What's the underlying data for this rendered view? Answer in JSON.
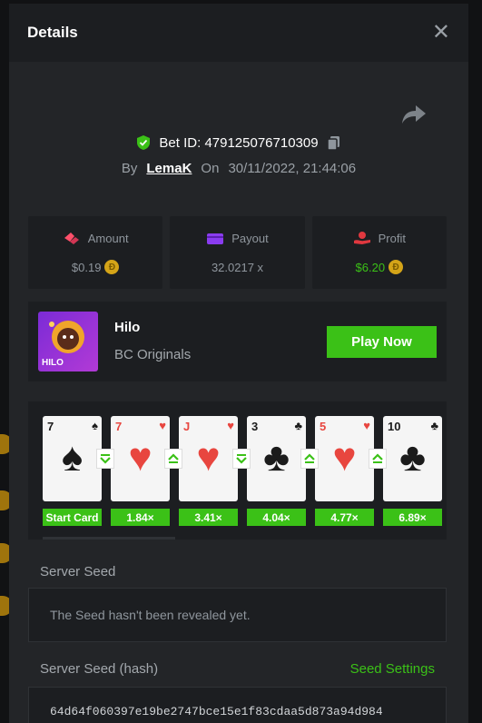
{
  "modal": {
    "title": "Details",
    "close_glyph": "✕"
  },
  "bet": {
    "id_label": "Bet ID: 479125076710309",
    "by_label": "By",
    "user": "LemaK",
    "on_label": "On",
    "datetime": "30/11/2022, 21:44:06"
  },
  "stats": [
    {
      "label": "Amount",
      "value": "$0.19",
      "icon": "amount-icon",
      "value_color": "#8f969d"
    },
    {
      "label": "Payout",
      "value": "32.0217 x",
      "icon": "payout-icon",
      "value_color": "#8f969d"
    },
    {
      "label": "Profit",
      "value": "$6.20",
      "icon": "profit-icon",
      "value_color": "#3bc117"
    }
  ],
  "coin_glyph": "Ð",
  "game": {
    "name": "Hilo",
    "provider": "BC Originals",
    "thumb_badge": "HILO",
    "play_label": "Play Now"
  },
  "cards": [
    {
      "rank": "7",
      "suit": "♠",
      "color": "#1b1b1b",
      "multiplier": "Start Card"
    },
    {
      "rank": "7",
      "suit": "♥",
      "color": "#e8463f",
      "multiplier": "1.84×",
      "move": "lower"
    },
    {
      "rank": "J",
      "suit": "♥",
      "color": "#e8463f",
      "multiplier": "3.41×",
      "move": "higher"
    },
    {
      "rank": "3",
      "suit": "♣",
      "color": "#1b1b1b",
      "multiplier": "4.04×",
      "move": "lower"
    },
    {
      "rank": "5",
      "suit": "♥",
      "color": "#e8463f",
      "multiplier": "4.77×",
      "move": "higher"
    },
    {
      "rank": "10",
      "suit": "♣",
      "color": "#1b1b1b",
      "multiplier": "6.89×",
      "move": "higher"
    }
  ],
  "server_seed": {
    "label": "Server Seed",
    "value": "The Seed hasn't been revealed yet."
  },
  "server_seed_hash": {
    "label": "Server Seed (hash)",
    "link": "Seed Settings",
    "value": "64d64f060397e19be2747bce15e1f83cdaa5d873a94d984"
  },
  "colors": {
    "accent_green": "#3bc117",
    "panel": "#1c1e21",
    "modal_bg": "#232528"
  }
}
